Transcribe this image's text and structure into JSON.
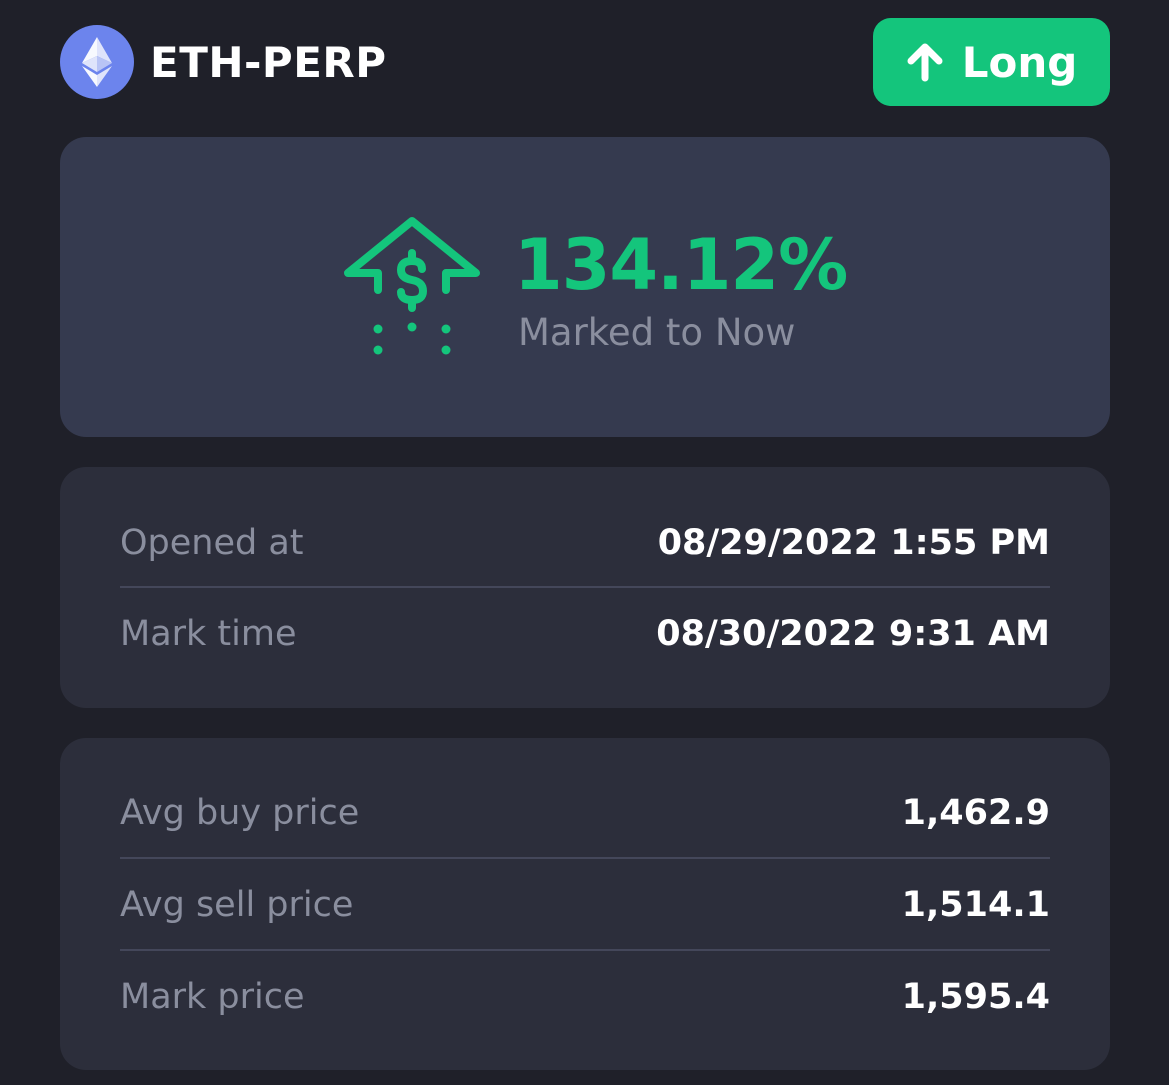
{
  "header": {
    "pair": "ETH-PERP",
    "side": "Long",
    "coin_icon": "ethereum-icon",
    "side_icon": "arrow-up-icon"
  },
  "pnl": {
    "value": "134.12%",
    "caption": "Marked to Now",
    "icon": "dollar-up-arrow-icon"
  },
  "times": [
    {
      "label": "Opened at",
      "value": "08/29/2022 1:55 PM"
    },
    {
      "label": "Mark time",
      "value": "08/30/2022 9:31 AM"
    }
  ],
  "prices": [
    {
      "label": "Avg buy price",
      "value": "1,462.9"
    },
    {
      "label": "Avg sell price",
      "value": "1,514.1"
    },
    {
      "label": "Mark price",
      "value": "1,595.4"
    }
  ],
  "colors": {
    "background": "#1f2029",
    "accent_green": "#14c57c",
    "card_highlight": "#353a4f",
    "card": "#2c2e3b",
    "muted_text": "#8a8e9e",
    "eth_blue": "#6c84ed"
  }
}
